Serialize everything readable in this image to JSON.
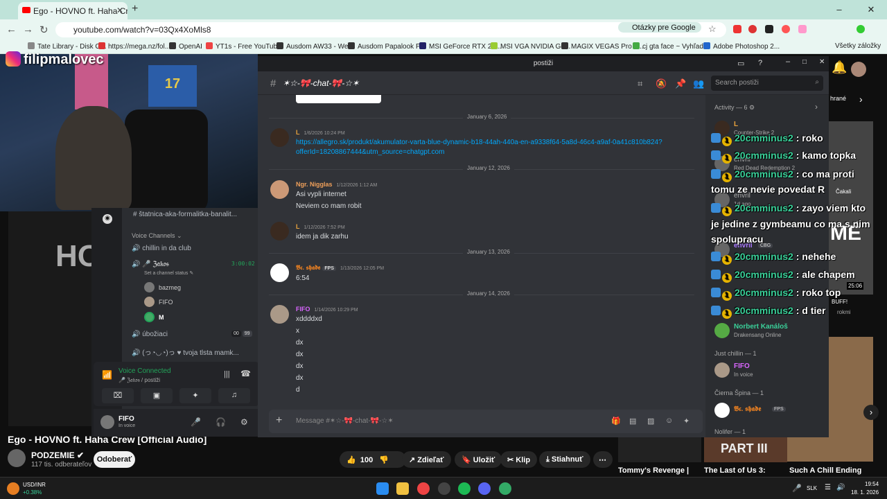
{
  "browser": {
    "tab_title": "Ego - HOVNO ft. Haha Crew (O",
    "url": "youtube.com/watch?v=03Qx4XoMls8",
    "translate_pill": "Otázky pre Google",
    "bookmarks": [
      {
        "label": "Tate Library - Disk G..."
      },
      {
        "label": "https://mega.nz/fol..."
      },
      {
        "label": "OpenAI"
      },
      {
        "label": "YT1s - Free YouTub..."
      },
      {
        "label": "Ausdom AW33 - We..."
      },
      {
        "label": "Ausdom Papalook P..."
      },
      {
        "label": "MSI GeForce RTX 20..."
      },
      {
        "label": "MSI VGA NVIDIA Ge..."
      },
      {
        "label": "MAGIX VEGAS Pro 1..."
      },
      {
        "label": "cj gta face ~ Vyhľad..."
      },
      {
        "label": "Adobe Photoshop 2..."
      },
      {
        "label": "Všetky záložky"
      }
    ]
  },
  "stream": {
    "instagram_handle": "filipmalovec",
    "jersey_number": "17"
  },
  "youtube": {
    "video_title": "Ego - HOVNO ft. Haha Crew [Official Audio]",
    "thumbnail_text": "HOV",
    "channel_name": "PODZEMIE",
    "subscribers": "117 tis. odberateľov",
    "subscribe_label": "Odoberať",
    "likes": "100",
    "share_label": "Zdieľať",
    "save_label": "Uložiť",
    "clip_label": "Klip",
    "download_label": "Stiahnuť",
    "more_label": "⋯",
    "recommendations": [
      {
        "title": "Tommy's Revenge |"
      },
      {
        "title": "The Last of Us 3:"
      },
      {
        "title": "Such A Chill Ending"
      }
    ],
    "right_thumb_labels": [
      "hrané",
      "MÉ",
      "25:06",
      "BUFF!",
      "rokmi",
      "Čakali",
      "PART III"
    ]
  },
  "discord": {
    "window_title": "postiži",
    "channel_title": "✶☆-🎀-chat-🎀-☆✶",
    "search_placeholder": "Search postiži",
    "composer_placeholder": "Message #✶☆-🎀-chat-🎀-☆✶",
    "dates": [
      "January 6, 2026",
      "January 12, 2026",
      "January 13, 2026",
      "January 14, 2026"
    ],
    "messages": [
      {
        "author": "L",
        "time": "1/6/2026 10:24 PM",
        "color": "#e8a23d",
        "lines": [
          "https://allegro.sk/produkt/akumulator-varta-blue-dynamic-b18-44ah-440a-en-a9338f64-5a8d-46c4-a9af-0a41c810b824?",
          "offerId=18208867444&utm_source=chatgpt.com"
        ]
      },
      {
        "author": "Ngr. Nigglas",
        "time": "1/12/2026 1:12 AM",
        "color": "#f0a05a",
        "lines": [
          "Asi vypli internet",
          "Neviem co mam robit"
        ]
      },
      {
        "author": "L",
        "time": "1/12/2026 7:52 PM",
        "color": "#e8a23d",
        "lines": [
          "idem ja dik zarhu"
        ]
      },
      {
        "author": "𝕭𝖈. 𝖘𝖍𝖆𝖉𝖊",
        "tag": "FPS",
        "time": "1/13/2026 12:05 PM",
        "color": "#e67e22",
        "lines": [
          "6:54"
        ]
      },
      {
        "author": "FIFO",
        "time": "1/14/2026 10:29 PM",
        "color": "#d966ff",
        "lines": [
          "xddddxd",
          "x",
          "dx",
          "dx",
          "dx",
          "dx",
          "d"
        ]
      }
    ],
    "members": {
      "activity_header": "Activity — 6",
      "activity": [
        {
          "name": "L",
          "status": "Counter-Strike 2"
        },
        {
          "name": "envril",
          "status": "Red Dead Redemption 2"
        },
        {
          "name": "envril",
          "status": "1d ago"
        },
        {
          "name": "envril",
          "status": "CBG"
        },
        {
          "name": "Norbert Kanáloš",
          "status": "Drakensang Online"
        }
      ],
      "just_chillin_header": "Just chillin — 1",
      "fifo": {
        "name": "FIFO",
        "status": "In voice"
      },
      "cierna_header": "Čierna Špina — 1",
      "shade": {
        "name": "𝕭𝖈. 𝖘𝖍𝖆𝖉𝖊",
        "tag": "FPS"
      },
      "nolifer_header": "Nolifer — 1"
    },
    "sidebar": {
      "top_channel": "štatnica-aka-formalitka-banalit...",
      "voice_header": "Voice Channels",
      "channels": [
        {
          "name": "chillin in da club"
        },
        {
          "name": "🎤 ℨ𝔞𝔨𝔬𝔰",
          "timer": "3:00:02",
          "sub": "Set a channel status"
        },
        {
          "name": "úbožiaci",
          "counts": [
            "00",
            "99"
          ]
        },
        {
          "name": "(っ◔◡◔)っ ♥ tvoja tlsta mamk..."
        }
      ],
      "voice_users": [
        "bazmeg",
        "FIFO",
        "M"
      ],
      "voice_connected": "Voice Connected",
      "voice_location": "🎤 ℨ𝔞𝔨𝔬𝔰 / postiži",
      "user_name": "FIFO",
      "user_status": "In voice"
    }
  },
  "overlay_chat": [
    {
      "user": "20cmminus2",
      "msg": "roko"
    },
    {
      "user": "20cmminus2",
      "msg": "kamo topka"
    },
    {
      "user": "20cmminus2",
      "msg": "co ma proti"
    },
    {
      "user": "",
      "msg": "tomu ze nevie povedat R"
    },
    {
      "user": "20cmminus2",
      "msg": "zayo viem kto"
    },
    {
      "user": "",
      "msg": "je jedine z gymbeamu co ma s nim"
    },
    {
      "user": "",
      "msg": "spolupracu"
    },
    {
      "user": "20cmminus2",
      "msg": "nehehe"
    },
    {
      "user": "20cmminus2",
      "msg": "ale chapem"
    },
    {
      "user": "20cmminus2",
      "msg": "roko top"
    },
    {
      "user": "20cmminus2",
      "msg": "d tier"
    }
  ],
  "taskbar": {
    "ticker_name": "USD/INR",
    "ticker_change": "+0.38%",
    "lang": "SLK",
    "time": "19:54",
    "date": "18. 1. 2026"
  }
}
